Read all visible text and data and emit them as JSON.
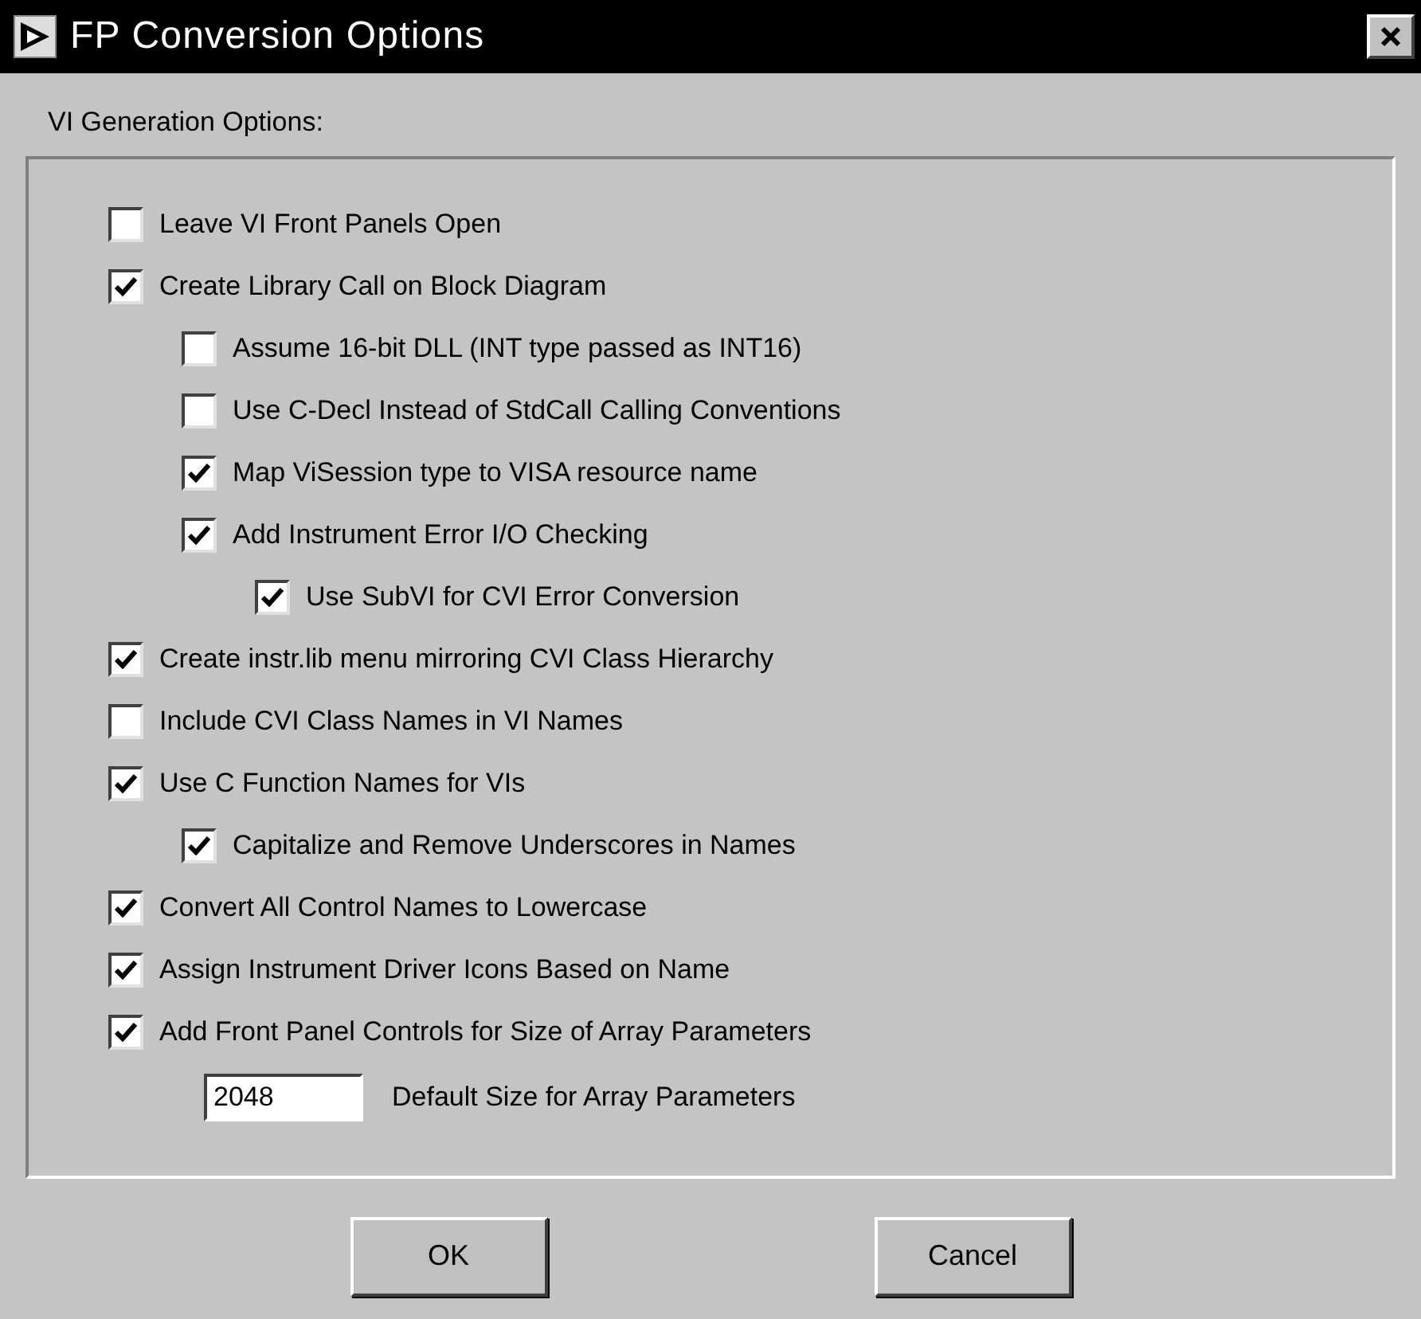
{
  "window": {
    "title": "FP Conversion Options"
  },
  "group": {
    "label": "VI Generation Options:",
    "options": [
      {
        "label": "Leave VI Front Panels Open",
        "checked": false
      },
      {
        "label": "Create Library Call on Block Diagram",
        "checked": true,
        "children": [
          {
            "label": "Assume 16-bit DLL (INT type passed as INT16)",
            "checked": false
          },
          {
            "label": "Use C-Decl Instead of StdCall Calling Conventions",
            "checked": false
          },
          {
            "label": "Map ViSession type to VISA resource name",
            "checked": true
          },
          {
            "label": "Add Instrument Error I/O Checking",
            "checked": true,
            "children": [
              {
                "label": "Use SubVI for CVI Error Conversion",
                "checked": true
              }
            ]
          }
        ]
      },
      {
        "label": "Create instr.lib menu mirroring CVI Class Hierarchy",
        "checked": true
      },
      {
        "label": "Include CVI Class Names in VI Names",
        "checked": false
      },
      {
        "label": "Use C Function Names for VIs",
        "checked": true,
        "children": [
          {
            "label": "Capitalize and Remove Underscores in Names",
            "checked": true
          }
        ]
      },
      {
        "label": "Convert All Control Names to Lowercase",
        "checked": true
      },
      {
        "label": "Assign Instrument Driver Icons Based on Name",
        "checked": true
      },
      {
        "label": "Add Front Panel Controls for Size of Array Parameters",
        "checked": true
      }
    ],
    "array_size": {
      "value": "2048",
      "label": "Default Size for Array Parameters"
    }
  },
  "buttons": [
    "OK",
    "Cancel"
  ]
}
